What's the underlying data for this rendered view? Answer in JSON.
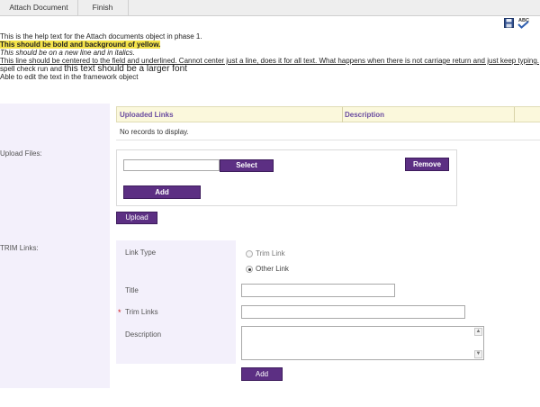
{
  "tabs": {
    "attach": "Attach Document",
    "finish": "Finish"
  },
  "toolbar": {
    "save_icon": "save-icon",
    "spell_icon": "spellcheck-icon",
    "spell_text": "ABC"
  },
  "help": {
    "line1": "This is the help text for the Attach documents object in phase 1.",
    "line2": "This should be bold and background of yellow.",
    "line3": "This should be on a new line and in italics.",
    "line4": "This line should be centered to the field and underlined. Cannot center just a line, does it for all text.  What happens when there is not carriage return and just keep typing.",
    "line5_a": "spell check run and ",
    "line5_b": "this text should be a larger font",
    "line6": "Able to edit the text in the framework object"
  },
  "upload": {
    "label": "Upload Files:",
    "col_links": "Uploaded Links",
    "col_description": "Description",
    "no_records": "No records to display.",
    "file_value": "",
    "select_btn": "Select",
    "remove_btn": "Remove",
    "add_btn": "Add",
    "upload_btn": "Upload"
  },
  "trim": {
    "label": "TRIM Links:",
    "link_type_label": "Link Type",
    "option_trim": "Trim Link",
    "option_other": "Other Link",
    "selected": "Other Link",
    "title_label": "Title",
    "title_value": "",
    "trim_links_label": "Trim Links",
    "trim_links_value": "",
    "description_label": "Description",
    "description_value": "",
    "required_mark": "*",
    "add_btn": "Add"
  },
  "colors": {
    "accent": "#5c2f83",
    "highlight": "#f5e34a",
    "panel": "#f3f0fb",
    "header": "#fbf8dc"
  }
}
